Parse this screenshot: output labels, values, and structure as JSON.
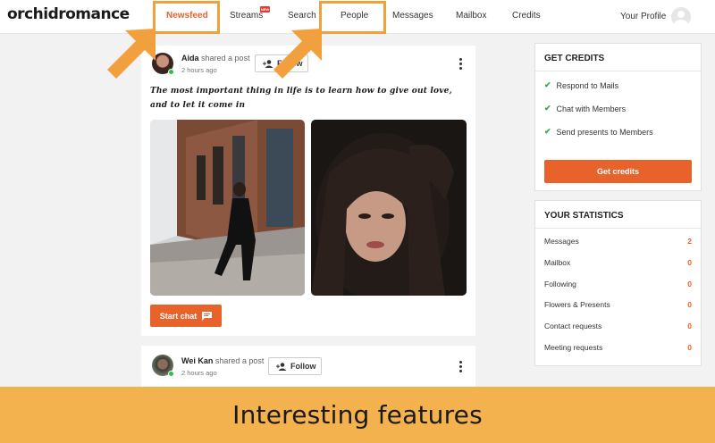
{
  "header": {
    "logo": "orchidromance",
    "nav": [
      {
        "label": "Newsfeed",
        "active": true
      },
      {
        "label": "Streams",
        "badge": "NEW"
      },
      {
        "label": "Search"
      },
      {
        "label": "People"
      },
      {
        "label": "Messages"
      },
      {
        "label": "Mailbox"
      },
      {
        "label": "Credits"
      }
    ],
    "profile_label": "Your Profile"
  },
  "feed": {
    "posts": [
      {
        "author": "Aida",
        "action": "shared a post",
        "time": "2 hours ago",
        "follow_label": "Follow",
        "text": "The most important thing in life is to learn how to give out love, and to let it come in",
        "chat_label": "Start chat",
        "online": true
      },
      {
        "author": "Wei Kan",
        "action": "shared a post",
        "time": "2 hours ago",
        "follow_label": "Follow",
        "online": true
      }
    ]
  },
  "credits_panel": {
    "title": "GET CREDITS",
    "items": [
      "Respond to Mails",
      "Chat with Members",
      "Send presents to Members"
    ],
    "button_label": "Get credits"
  },
  "stats_panel": {
    "title": "YOUR STATISTICS",
    "rows": [
      {
        "label": "Messages",
        "value": "2"
      },
      {
        "label": "Mailbox",
        "value": "0"
      },
      {
        "label": "Following",
        "value": "0"
      },
      {
        "label": "Flowers & Presents",
        "value": "0"
      },
      {
        "label": "Contact requests",
        "value": "0"
      },
      {
        "label": "Meeting requests",
        "value": "0"
      }
    ]
  },
  "banner": {
    "text": "Interesting features"
  },
  "colors": {
    "accent": "#e8622b",
    "highlight": "#f2a03d",
    "banner": "#f4b24f",
    "online": "#2ebd4f"
  }
}
